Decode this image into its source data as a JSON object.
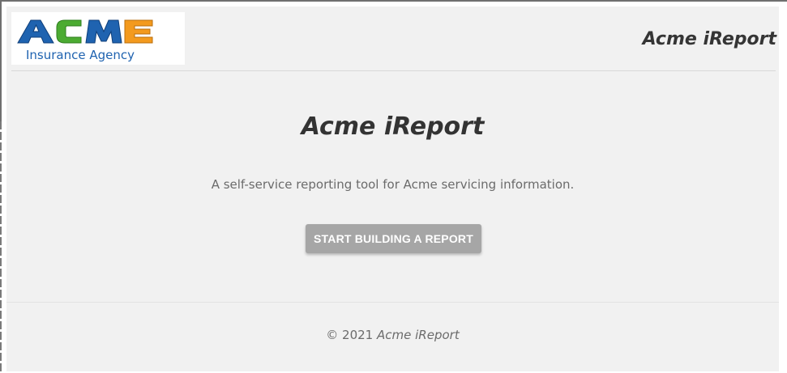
{
  "header": {
    "logo": {
      "wordmark": "ACME",
      "subtitle": "Insurance Agency"
    },
    "title": "Acme iReport"
  },
  "hero": {
    "title": "Acme iReport",
    "tagline": "A self-service reporting tool for Acme servicing information.",
    "cta_label": "START BUILDING A REPORT"
  },
  "footer": {
    "copyright": "© 2021",
    "brand": "Acme iReport"
  },
  "colors": {
    "background": "#f1f1f1",
    "button": "#a6a6a6",
    "logo_blue": "#1f63b0",
    "logo_green": "#4cab32",
    "logo_orange": "#f39a1e"
  }
}
